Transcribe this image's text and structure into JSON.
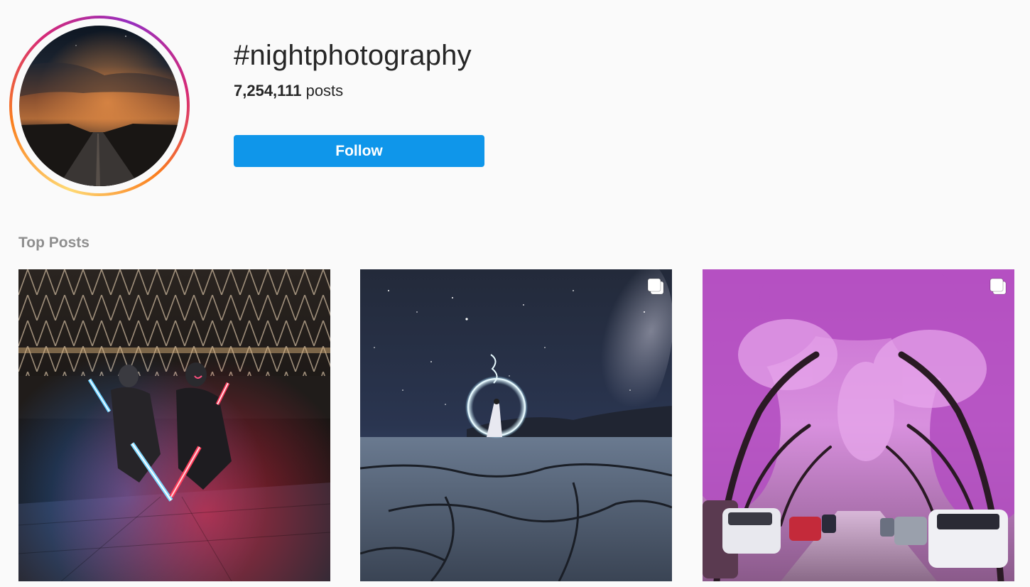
{
  "header": {
    "hashtag": "#nightphotography",
    "post_count": "7,254,111",
    "post_count_label": "posts",
    "follow_label": "Follow"
  },
  "top_posts": {
    "title": "Top Posts",
    "items": [
      {
        "subject": "two masked people with glowing red and blue light sabers under a geometric canopy",
        "multiple_images": false
      },
      {
        "subject": "woman in white dress inside a light-painted circle under the milky way on cracked desert floor",
        "multiple_images": true
      },
      {
        "subject": "street lined with pink cherry blossom trees and parked cars",
        "multiple_images": true
      }
    ]
  },
  "colors": {
    "background": "#fafafa",
    "follow_button": "#0f96ea",
    "section_title": "#8e8e8e",
    "story_ring": [
      "#feda75",
      "#fa7e1e",
      "#d62976",
      "#962fbf"
    ]
  },
  "icons": {
    "multiple_images": "carousel-icon"
  }
}
